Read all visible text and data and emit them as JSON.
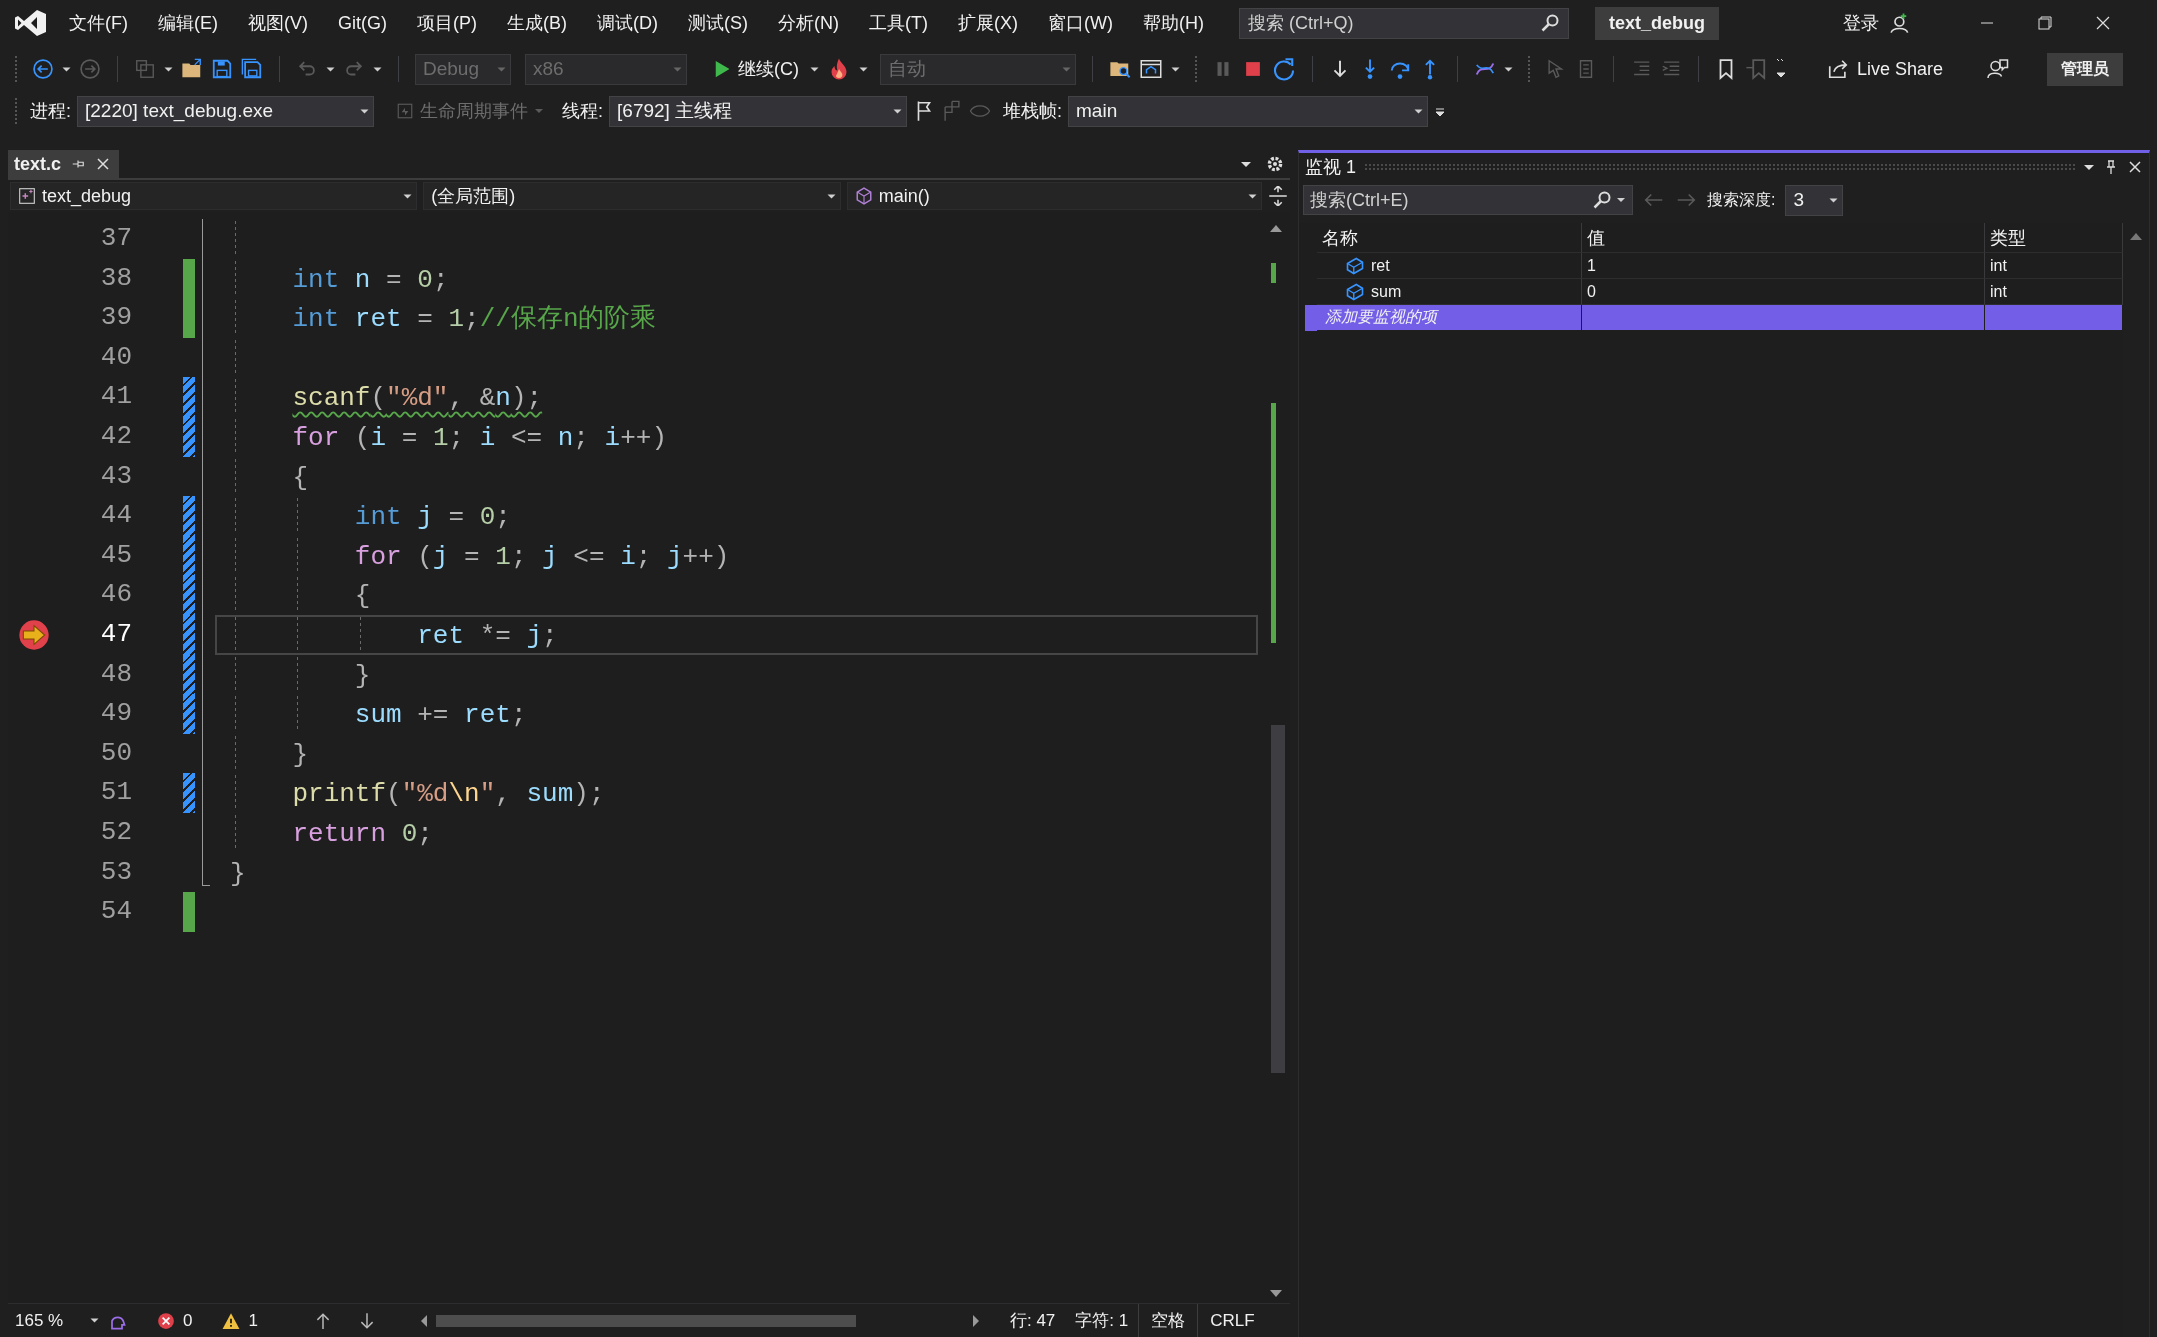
{
  "title_bar": {
    "menus": [
      "文件(F)",
      "编辑(E)",
      "视图(V)",
      "Git(G)",
      "项目(P)",
      "生成(B)",
      "调试(D)",
      "测试(S)",
      "分析(N)",
      "工具(T)",
      "扩展(X)",
      "窗口(W)",
      "帮助(H)"
    ],
    "search": {
      "placeholder": "搜索 (Ctrl+Q)"
    },
    "solution_name": "text_debug",
    "sign_in": "登录"
  },
  "toolbar": {
    "configuration": {
      "value": "Debug",
      "disabled": true
    },
    "platform": {
      "value": "x86",
      "disabled": true
    },
    "continue": "继续(C)",
    "auto": {
      "value": "自动",
      "disabled": true
    },
    "live_share": "Live Share",
    "admin": "管理员"
  },
  "debug_location": {
    "process_label": "进程:",
    "process": "[2220] text_debug.exe",
    "lifecycle": {
      "label": "生命周期事件",
      "disabled": true
    },
    "thread_label": "线程:",
    "thread": "[6792] 主线程",
    "stack_frame_label": "堆栈帧:",
    "stack_frame": "main"
  },
  "editor": {
    "tabs": [
      {
        "label": "text.c",
        "selected": true
      }
    ],
    "nav": {
      "project": "text_debug",
      "scope": "(全局范围)",
      "member": "main()"
    },
    "lines": [
      {
        "number": "37",
        "saved": false,
        "modified": false,
        "current": false,
        "warning": false
      },
      {
        "number": "38",
        "saved": true,
        "modified": false,
        "current": false,
        "warning": false,
        "tokens": [
          {
            "kind": "type",
            "text": "    int"
          },
          {
            "kind": "id",
            "text": " n"
          },
          {
            "kind": "op",
            "text": " = "
          },
          {
            "kind": "num",
            "text": "0"
          },
          {
            "kind": "op",
            "text": ";"
          }
        ]
      },
      {
        "number": "39",
        "saved": true,
        "modified": false,
        "current": false,
        "warning": false,
        "tokens": [
          {
            "kind": "type",
            "text": "    int"
          },
          {
            "kind": "id",
            "text": " ret"
          },
          {
            "kind": "op",
            "text": " = "
          },
          {
            "kind": "num",
            "text": "1"
          },
          {
            "kind": "op",
            "text": ";"
          },
          {
            "kind": "comment",
            "text": "//保存n的阶乘"
          }
        ]
      },
      {
        "number": "40",
        "saved": false,
        "modified": false,
        "current": false,
        "warning": false
      },
      {
        "number": "41",
        "saved": false,
        "modified": true,
        "current": false,
        "warning": true,
        "tokens": [
          {
            "kind": "fn",
            "text": "    scanf"
          },
          {
            "kind": "op",
            "text": "("
          },
          {
            "kind": "str",
            "text": "\"%d\""
          },
          {
            "kind": "op",
            "text": ", &"
          },
          {
            "kind": "id",
            "text": "n"
          },
          {
            "kind": "op",
            "text": ");"
          }
        ]
      },
      {
        "number": "42",
        "saved": false,
        "modified": true,
        "current": false,
        "warning": false,
        "tokens": [
          {
            "kind": "control",
            "text": "    for"
          },
          {
            "kind": "op",
            "text": " ("
          },
          {
            "kind": "id",
            "text": "i"
          },
          {
            "kind": "op",
            "text": " = "
          },
          {
            "kind": "num",
            "text": "1"
          },
          {
            "kind": "op",
            "text": "; "
          },
          {
            "kind": "id",
            "text": "i"
          },
          {
            "kind": "op",
            "text": " <= "
          },
          {
            "kind": "id",
            "text": "n"
          },
          {
            "kind": "op",
            "text": "; "
          },
          {
            "kind": "id",
            "text": "i"
          },
          {
            "kind": "op",
            "text": "++)"
          }
        ]
      },
      {
        "number": "43",
        "saved": false,
        "modified": false,
        "current": false,
        "warning": false,
        "tokens": [
          {
            "kind": "op",
            "text": "    {"
          }
        ]
      },
      {
        "number": "44",
        "saved": false,
        "modified": true,
        "current": false,
        "warning": false,
        "tokens": [
          {
            "kind": "type",
            "text": "        int"
          },
          {
            "kind": "id",
            "text": " j"
          },
          {
            "kind": "op",
            "text": " = "
          },
          {
            "kind": "num",
            "text": "0"
          },
          {
            "kind": "op",
            "text": ";"
          }
        ]
      },
      {
        "number": "45",
        "saved": false,
        "modified": true,
        "current": false,
        "warning": false,
        "tokens": [
          {
            "kind": "control",
            "text": "        for"
          },
          {
            "kind": "op",
            "text": " ("
          },
          {
            "kind": "id",
            "text": "j"
          },
          {
            "kind": "op",
            "text": " = "
          },
          {
            "kind": "num",
            "text": "1"
          },
          {
            "kind": "op",
            "text": "; "
          },
          {
            "kind": "id",
            "text": "j"
          },
          {
            "kind": "op",
            "text": " <= "
          },
          {
            "kind": "id",
            "text": "i"
          },
          {
            "kind": "op",
            "text": "; "
          },
          {
            "kind": "id",
            "text": "j"
          },
          {
            "kind": "op",
            "text": "++)"
          }
        ]
      },
      {
        "number": "46",
        "saved": false,
        "modified": true,
        "current": false,
        "warning": false,
        "tokens": [
          {
            "kind": "op",
            "text": "        {"
          }
        ]
      },
      {
        "number": "47",
        "saved": false,
        "modified": true,
        "current": true,
        "warning": false,
        "tokens": [
          {
            "kind": "id",
            "text": "            ret"
          },
          {
            "kind": "op",
            "text": " *= "
          },
          {
            "kind": "id",
            "text": "j"
          },
          {
            "kind": "op",
            "text": ";"
          }
        ]
      },
      {
        "number": "48",
        "saved": false,
        "modified": true,
        "current": false,
        "warning": false,
        "tokens": [
          {
            "kind": "op",
            "text": "        }"
          }
        ]
      },
      {
        "number": "49",
        "saved": false,
        "modified": true,
        "current": false,
        "warning": false,
        "tokens": [
          {
            "kind": "id",
            "text": "        sum"
          },
          {
            "kind": "op",
            "text": " += "
          },
          {
            "kind": "id",
            "text": "ret"
          },
          {
            "kind": "op",
            "text": ";"
          }
        ]
      },
      {
        "number": "50",
        "saved": false,
        "modified": false,
        "current": false,
        "warning": false,
        "tokens": [
          {
            "kind": "op",
            "text": "    }"
          }
        ]
      },
      {
        "number": "51",
        "saved": false,
        "modified": true,
        "current": false,
        "warning": false,
        "tokens": [
          {
            "kind": "fn",
            "text": "    printf"
          },
          {
            "kind": "op",
            "text": "("
          },
          {
            "kind": "str",
            "text": "\"%d"
          },
          {
            "kind": "esc",
            "text": "\\n"
          },
          {
            "kind": "str",
            "text": "\""
          },
          {
            "kind": "op",
            "text": ", "
          },
          {
            "kind": "id",
            "text": "sum"
          },
          {
            "kind": "op",
            "text": ");"
          }
        ]
      },
      {
        "number": "52",
        "saved": false,
        "modified": false,
        "current": false,
        "warning": false,
        "tokens": [
          {
            "kind": "control",
            "text": "    return"
          },
          {
            "kind": "num",
            "text": " 0"
          },
          {
            "kind": "op",
            "text": ";"
          }
        ]
      },
      {
        "number": "53",
        "saved": false,
        "modified": false,
        "current": false,
        "warning": false,
        "tokens": [
          {
            "kind": "op",
            "text": "}"
          }
        ]
      },
      {
        "number": "54",
        "saved": true,
        "modified": false,
        "current": false,
        "warning": false
      }
    ],
    "status": {
      "zoom": "165 %",
      "errors": "0",
      "warnings": "1",
      "line": "行: 47",
      "column": "字符: 1",
      "whitespace": "空格",
      "line_ending": "CRLF"
    }
  },
  "watch": {
    "title": "监视 1",
    "search": {
      "placeholder": "搜索(Ctrl+E)"
    },
    "depth_label": "搜索深度:",
    "depth": "3",
    "columns": [
      "名称",
      "值",
      "类型"
    ],
    "rows": [
      {
        "kind": "variable",
        "name": "ret",
        "value": "1",
        "type": "int",
        "selected": false
      },
      {
        "kind": "variable",
        "name": "sum",
        "value": "0",
        "type": "int",
        "selected": false
      },
      {
        "kind": "add",
        "name": "添加要监视的项",
        "selected": true
      }
    ]
  }
}
